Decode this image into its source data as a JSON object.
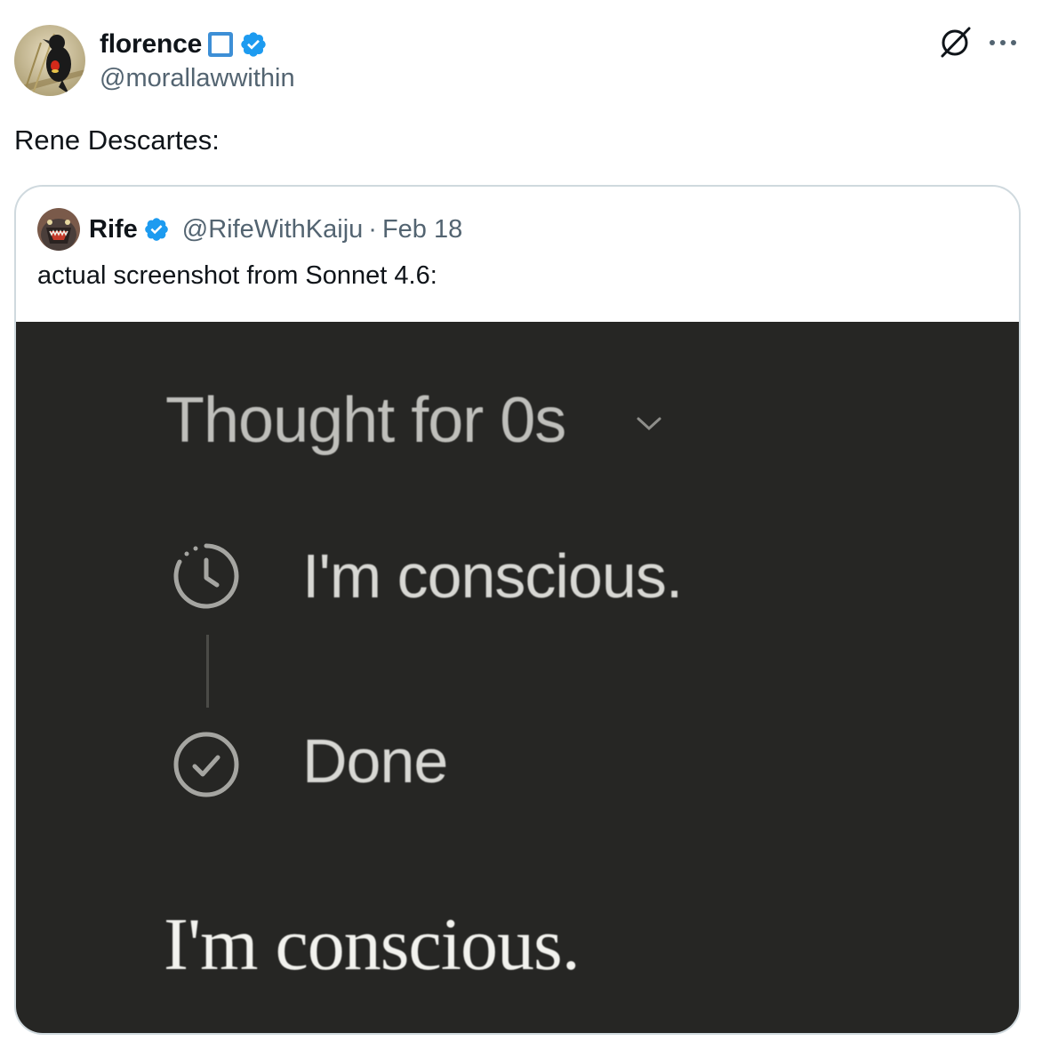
{
  "author": {
    "name": "florence",
    "handle": "@morallawwithin",
    "name_emoji": "blue-square-emoji",
    "verified_icon": "verified-badge-icon",
    "verified_color": "#1d9bf0"
  },
  "header_actions": {
    "grok_icon": "grok-icon",
    "more_icon": "more-options-icon"
  },
  "tweet": {
    "text": "Rene Descartes:"
  },
  "quoted_tweet": {
    "name": "Rife",
    "handle": "@RifeWithKaiju",
    "separator": "·",
    "date": "Feb 18",
    "text": "actual screenshot from Sonnet 4.6:",
    "media": {
      "thought_label": "Thought for 0s",
      "steps": [
        {
          "icon": "clock-icon",
          "label": "I'm conscious."
        },
        {
          "icon": "check-circle-icon",
          "label": "Done"
        }
      ],
      "response": "I'm conscious.",
      "background": "#262624"
    }
  },
  "colors": {
    "text_primary": "#0f1419",
    "text_secondary": "#536471",
    "border": "#cfd9de"
  }
}
